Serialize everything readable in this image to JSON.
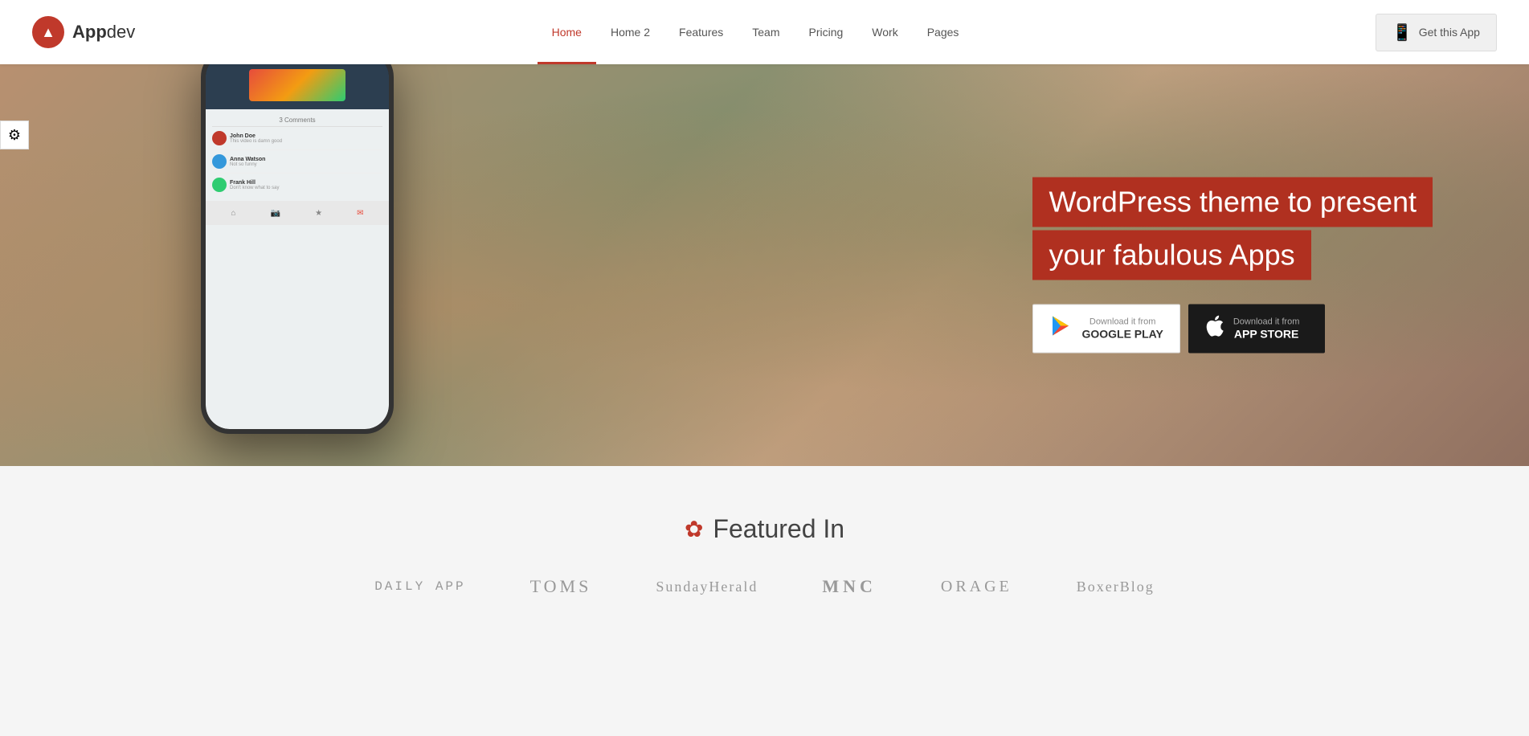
{
  "header": {
    "logo_text_part1": "App",
    "logo_text_part2": "dev",
    "logo_symbol": "▲",
    "nav": [
      {
        "label": "Home",
        "active": true,
        "id": "home"
      },
      {
        "label": "Home 2",
        "active": false,
        "id": "home2"
      },
      {
        "label": "Features",
        "active": false,
        "id": "features"
      },
      {
        "label": "Team",
        "active": false,
        "id": "team"
      },
      {
        "label": "Pricing",
        "active": false,
        "id": "pricing"
      },
      {
        "label": "Work",
        "active": false,
        "id": "work"
      },
      {
        "label": "Pages",
        "active": false,
        "id": "pages"
      }
    ],
    "cta_button": "Get this App",
    "phone_icon": "📱"
  },
  "settings": {
    "icon": "⚙"
  },
  "hero": {
    "title_line1": "WordPress theme to present",
    "title_line2": "your fabulous Apps",
    "google_play": {
      "label_top": "Download it from",
      "label_bottom": "GOOGLE PLAY",
      "icon": "▶"
    },
    "app_store": {
      "label_top": "Download it from",
      "label_bottom": "APP STORE",
      "icon": ""
    }
  },
  "featured": {
    "icon": "✿",
    "title": "Featured In",
    "brands": [
      {
        "label": "DAILY APP",
        "class": "brand-dailyapp"
      },
      {
        "label": "TOMS",
        "class": "brand-toms"
      },
      {
        "label": "SundayHerald",
        "class": "brand-sunday"
      },
      {
        "label": "MNC",
        "class": "brand-mnc"
      },
      {
        "label": "ORAGE",
        "class": "brand-orage"
      },
      {
        "label": "BoxerBlog",
        "class": "brand-boxer"
      }
    ]
  }
}
